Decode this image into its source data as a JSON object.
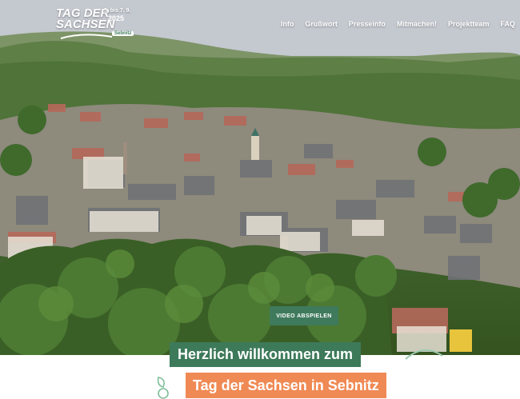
{
  "logo": {
    "line1": "TAG DER",
    "line2": "SACHSEN",
    "dates": "5. bis 7. 9.",
    "year": "2025",
    "tag": "Sebnitz"
  },
  "nav": {
    "items": [
      {
        "label": "Info"
      },
      {
        "label": "Grußwort"
      },
      {
        "label": "Presseinfo"
      },
      {
        "label": "Mitmachen!"
      },
      {
        "label": "Projektteam"
      },
      {
        "label": "FAQ"
      }
    ]
  },
  "hero": {
    "video_button": "VIDEO ABSPIELEN"
  },
  "headline": {
    "line1": "Herzlich willkommen zum",
    "line2": "Tag der Sachsen in Sebnitz"
  },
  "colors": {
    "accent_green": "#3d7a5a",
    "accent_orange": "#f08a55"
  }
}
